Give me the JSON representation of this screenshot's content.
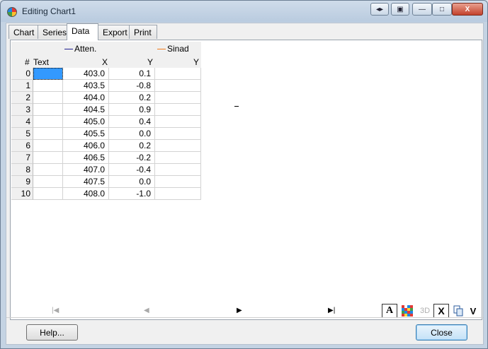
{
  "window": {
    "title": "Editing Chart1",
    "buttons": {
      "minimize": "—",
      "maximize": "□",
      "close": "X"
    }
  },
  "tabs": [
    {
      "label": "Chart"
    },
    {
      "label": "Series"
    },
    {
      "label": "Data",
      "active": true
    },
    {
      "label": "Export"
    },
    {
      "label": "Print"
    }
  ],
  "grid": {
    "series": [
      {
        "name": "Atten.",
        "color": "#1f1f8f"
      },
      {
        "name": "Sinad",
        "color": "#f07a1a"
      }
    ],
    "columns": {
      "index": "#",
      "text": "Text",
      "x": "X",
      "y": "Y",
      "y2": "Y"
    },
    "rows": [
      {
        "index": "0",
        "x": "403.0",
        "y": "0.1"
      },
      {
        "index": "1",
        "x": "403.5",
        "y": "-0.8"
      },
      {
        "index": "2",
        "x": "404.0",
        "y": "0.2"
      },
      {
        "index": "3",
        "x": "404.5",
        "y": "0.9"
      },
      {
        "index": "4",
        "x": "405.0",
        "y": "0.4"
      },
      {
        "index": "5",
        "x": "405.5",
        "y": "0.0"
      },
      {
        "index": "6",
        "x": "406.0",
        "y": "0.2"
      },
      {
        "index": "7",
        "x": "406.5",
        "y": "-0.2"
      },
      {
        "index": "8",
        "x": "407.0",
        "y": "-0.4"
      },
      {
        "index": "9",
        "x": "407.5",
        "y": "0.0"
      },
      {
        "index": "10",
        "x": "408.0",
        "y": "-1.0"
      }
    ]
  },
  "navigator": {
    "first": "|◀",
    "prev": "◀",
    "next": "▶",
    "last": "▶|"
  },
  "toolbar": {
    "font_button": "A",
    "colors_button": "",
    "three_d": "3D",
    "x_button": "X",
    "copy_button": "",
    "v_button": "V"
  },
  "footer": {
    "help_label": "Help...",
    "close_label": "Close"
  }
}
